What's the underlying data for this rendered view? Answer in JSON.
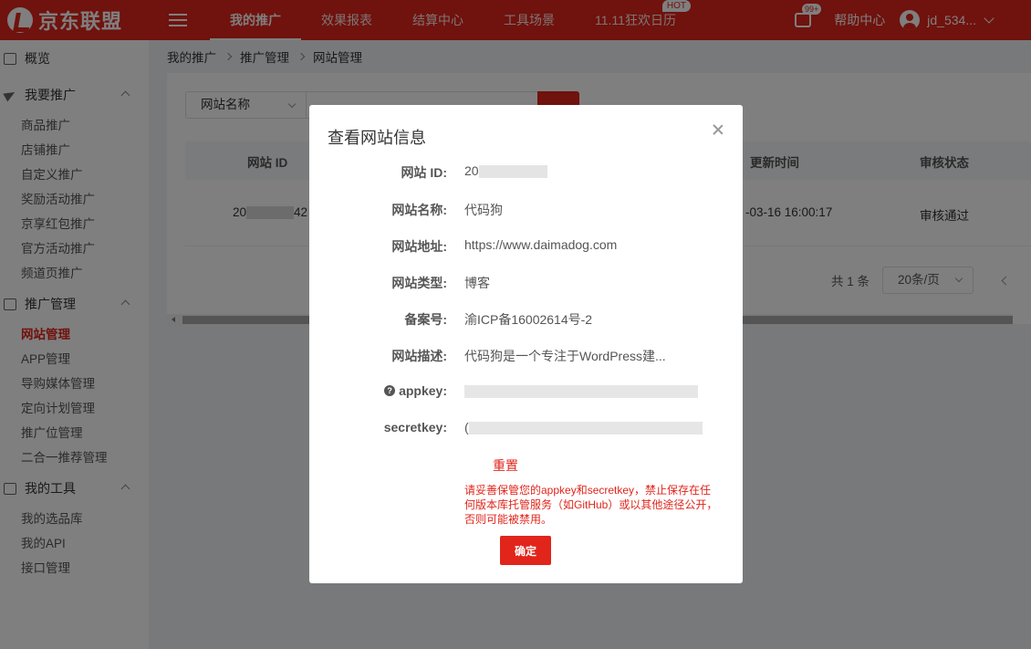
{
  "topbar": {
    "logo_text": "京东联盟",
    "nav": [
      {
        "label": "我的推广",
        "active": true
      },
      {
        "label": "效果报表"
      },
      {
        "label": "结算中心"
      },
      {
        "label": "工具场景"
      },
      {
        "label": "11.11狂欢日历",
        "badge": "HOT"
      }
    ],
    "message_badge": "99+",
    "help": "帮助中心",
    "username": "jd_534..."
  },
  "sidebar": {
    "overview": "概览",
    "groups": [
      {
        "label": "我要推广",
        "items": [
          "商品推广",
          "店铺推广",
          "自定义推广",
          "奖励活动推广",
          "京享红包推广",
          "官方活动推广",
          "频道页推广"
        ]
      },
      {
        "label": "推广管理",
        "items": [
          "网站管理",
          "APP管理",
          "导购媒体管理",
          "定向计划管理",
          "推广位管理",
          "二合一推荐管理"
        ],
        "active_item": "网站管理"
      },
      {
        "label": "我的工具",
        "items": [
          "我的选品库",
          "我的API",
          "接口管理"
        ]
      }
    ]
  },
  "breadcrumb": [
    "我的推广",
    "推广管理",
    "网站管理"
  ],
  "filter": {
    "select_value": "网站名称"
  },
  "table": {
    "headers": {
      "id": "网站 ID",
      "updated": "更新时间",
      "status": "审核状态"
    },
    "row": {
      "id_prefix": "20",
      "id_suffix": "42",
      "updated": "-03-16 16:00:17",
      "status": "审核通过"
    }
  },
  "pager": {
    "total": "共 1 条",
    "page_size": "20条/页"
  },
  "modal": {
    "title": "查看网站信息",
    "fields": [
      {
        "label": "网站 ID:",
        "value": "20"
      },
      {
        "label": "网站名称:",
        "value": "代码狗"
      },
      {
        "label": "网站地址:",
        "value": "https://www.daimadog.com"
      },
      {
        "label": "网站类型:",
        "value": "博客"
      },
      {
        "label": "备案号:",
        "value": "渝ICP备16002614号-2"
      },
      {
        "label": "网站描述:",
        "value": "代码狗是一个专注于WordPress建..."
      },
      {
        "label": "appkey:",
        "value": ""
      },
      {
        "label": "secretkey:",
        "value": "("
      }
    ],
    "reset": "重置",
    "warning": "请妥善保管您的appkey和secretkey，禁止保存在任何版本库托管服务（如GitHub）或以其他途径公开，否则可能被禁用。",
    "confirm": "确定"
  },
  "colors": {
    "brand": "#e1251b"
  }
}
